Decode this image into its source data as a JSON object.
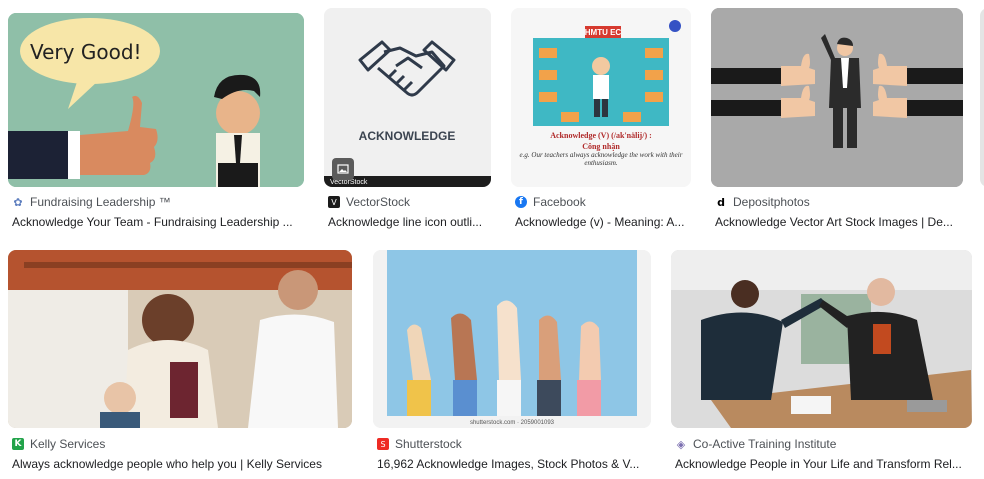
{
  "results": [
    {
      "source": "Fundraising Leadership ™",
      "title": "Acknowledge Your Team - Fundraising Leadership ...",
      "image_text": "Very Good!",
      "favicon": "flower-icon",
      "favicon_color": "#5f7fbf"
    },
    {
      "source": "VectorStock",
      "title": "Acknowledge line icon outli...",
      "image_text": "ACKNOWLEDGE",
      "watermark": "VectorStock",
      "favicon": "vectorstock-icon",
      "favicon_color": "#1a1a1a"
    },
    {
      "source": "Facebook",
      "title": "Acknowledge (v) - Meaning: A...",
      "image_banner": "HMTU EC",
      "image_heading": "Acknowledge (V) (/ak'nälij/) :",
      "image_meaning": "Công nhận",
      "image_example": "e.g. Our teachers always acknowledge the work with their enthusiasm.",
      "favicon": "facebook-icon",
      "favicon_color": "#1877f2"
    },
    {
      "source": "Depositphotos",
      "title": "Acknowledge Vector Art Stock Images | De...",
      "favicon": "depositphotos-icon",
      "favicon_color": "#000000"
    },
    {
      "source": "Kelly Services",
      "title": "Always acknowledge people who help you | Kelly Services",
      "favicon": "kelly-k-icon",
      "favicon_color": "#22a34a"
    },
    {
      "source": "Shutterstock",
      "title": "16,962 Acknowledge Images, Stock Photos & V...",
      "image_watermark": "shutterstock.com · 2059001093",
      "favicon": "shutterstock-icon",
      "favicon_color": "#ee2b24"
    },
    {
      "source": "Co-Active Training Institute",
      "title": "Acknowledge People in Your Life and Transform Rel...",
      "favicon": "coactive-icon",
      "favicon_color": "#7b6fb0"
    }
  ]
}
